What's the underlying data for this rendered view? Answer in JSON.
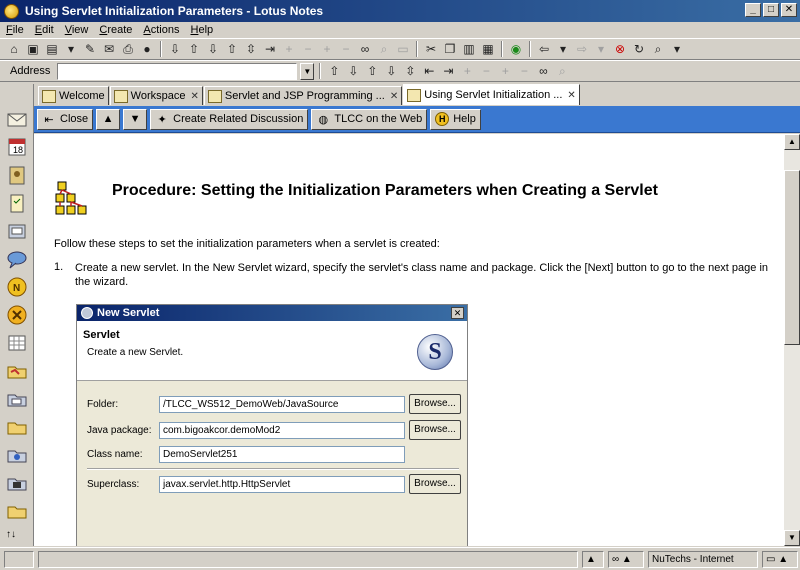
{
  "window": {
    "title": "Using Servlet Initialization Parameters - Lotus Notes",
    "min": "_",
    "max": "□",
    "close": "✕"
  },
  "menu": [
    {
      "label": "File",
      "key": "F",
      "rest": "ile"
    },
    {
      "label": "Edit",
      "key": "E",
      "rest": "dit"
    },
    {
      "label": "View",
      "key": "V",
      "rest": "iew"
    },
    {
      "label": "Create",
      "key": "C",
      "rest": "reate"
    },
    {
      "label": "Actions",
      "key": "A",
      "rest": "ctions"
    },
    {
      "label": "Help",
      "key": "H",
      "rest": "elp"
    }
  ],
  "address": {
    "label": "Address",
    "value": ""
  },
  "tabs": [
    {
      "label": "Welcome",
      "close": ""
    },
    {
      "label": "Workspace",
      "close": "✕"
    },
    {
      "label": "Servlet and JSP Programming ...",
      "close": "✕"
    },
    {
      "label": "Using Servlet Initialization ...",
      "close": "✕"
    }
  ],
  "actions": {
    "close": "Close",
    "create_related": "Create Related Discussion",
    "tlcc_web": "TLCC on the Web",
    "help": "Help"
  },
  "doc": {
    "heading": "Procedure: Setting the Initialization Parameters when Creating a Servlet",
    "intro": "Follow these steps to set the initialization parameters when a servlet is created:",
    "step1_num": "1.",
    "step1_text": "Create a new servlet. In the New Servlet wizard, specify the servlet's class name and package. Click the [Next] button to go to the next page in the wizard."
  },
  "dialog": {
    "title": "New Servlet",
    "header": "Servlet",
    "subheader": "Create a new Servlet.",
    "logo": "S",
    "folder_label": "Folder:",
    "folder_value": "/TLCC_WS512_DemoWeb/JavaSource",
    "package_label": "Java package:",
    "package_value": "com.bigoakcor.demoMod2",
    "class_label": "Class name:",
    "class_value": "DemoServlet251",
    "super_label": "Superclass:",
    "super_value": "javax.servlet.http.HttpServlet",
    "browse": "Browse..."
  },
  "status": {
    "location": "NuTechs - Internet"
  }
}
